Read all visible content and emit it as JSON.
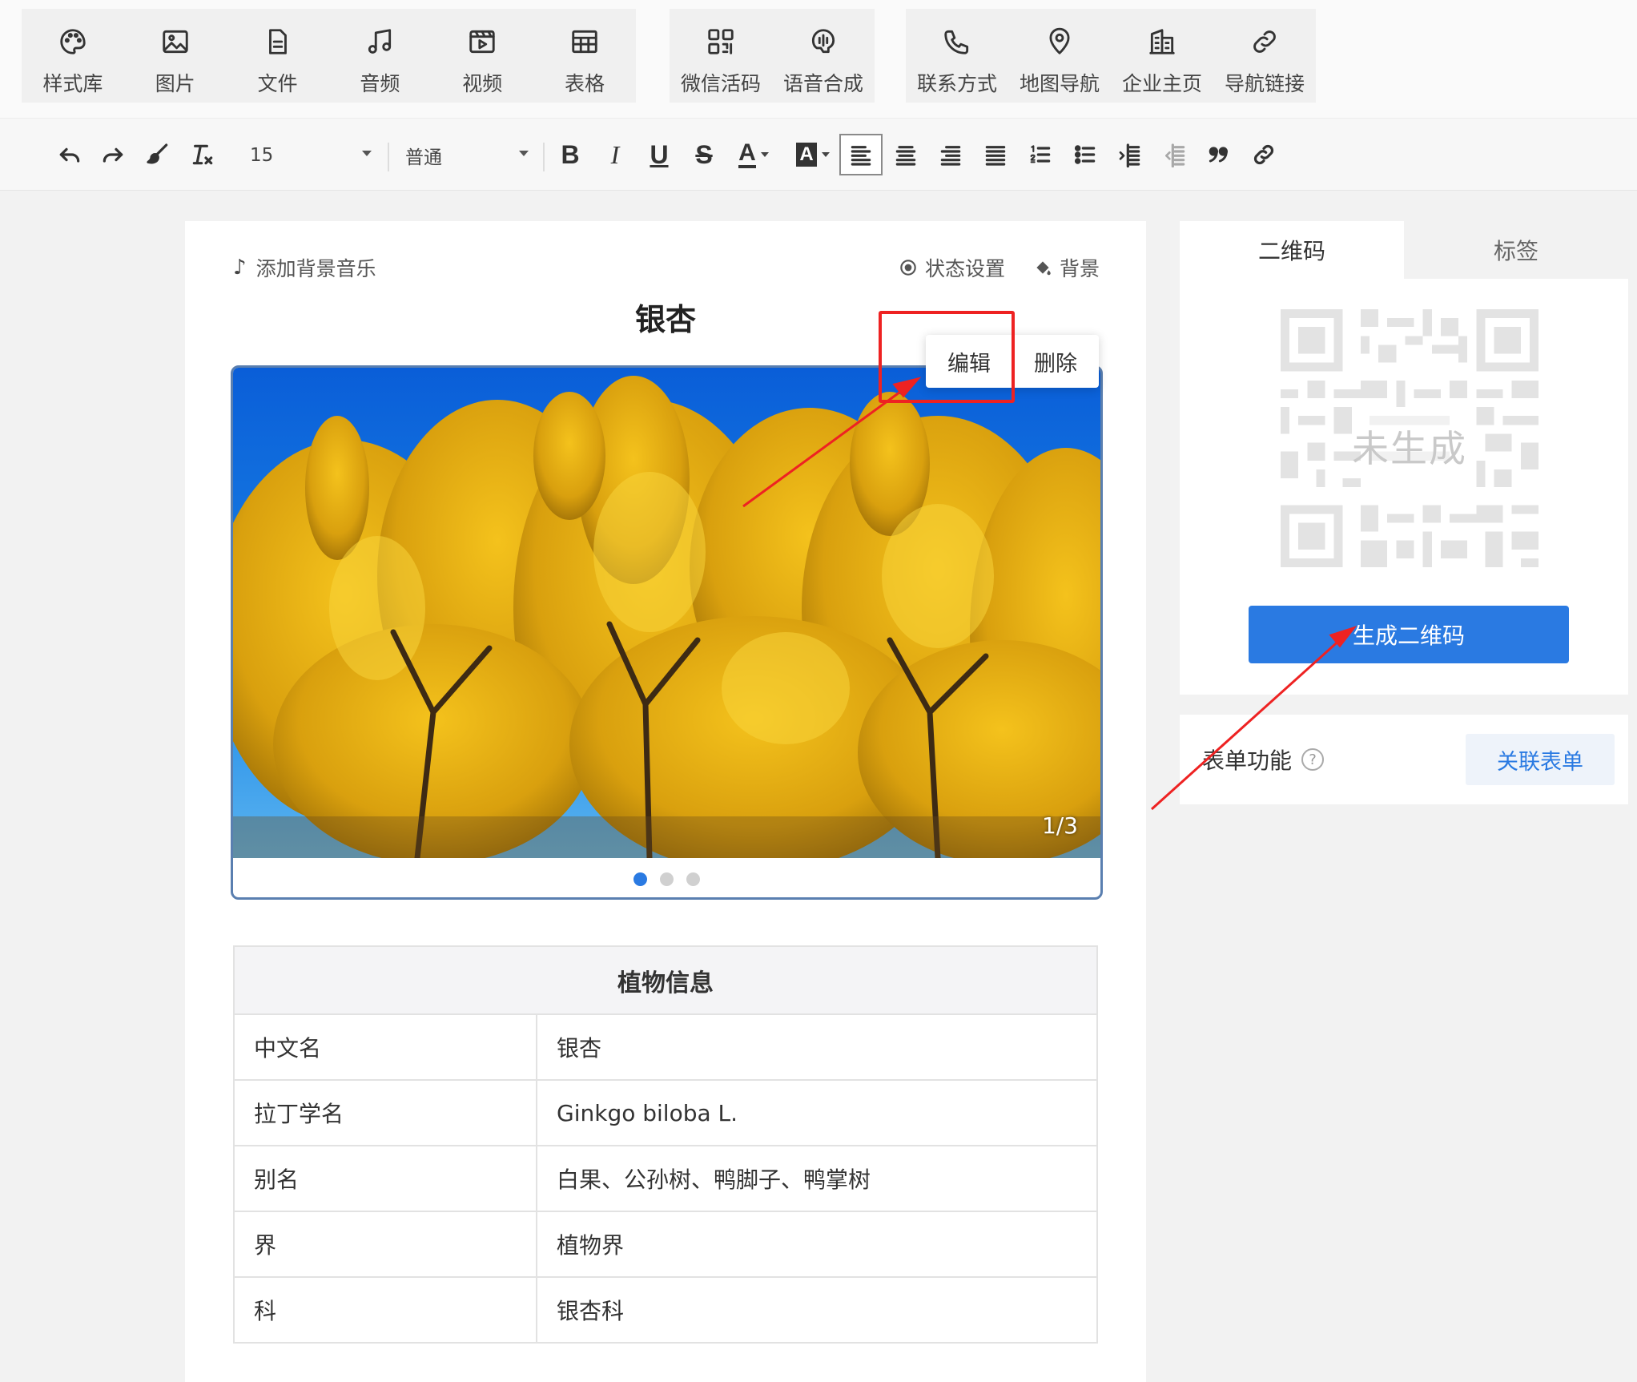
{
  "insert_toolbar": {
    "group1": [
      {
        "label": "样式库",
        "icon": "palette-icon"
      },
      {
        "label": "图片",
        "icon": "image-icon"
      },
      {
        "label": "文件",
        "icon": "file-icon"
      },
      {
        "label": "音频",
        "icon": "music-icon"
      },
      {
        "label": "视频",
        "icon": "video-icon"
      },
      {
        "label": "表格",
        "icon": "table-icon"
      }
    ],
    "group2": [
      {
        "label": "微信活码",
        "icon": "qrcode-icon"
      },
      {
        "label": "语音合成",
        "icon": "voice-icon"
      }
    ],
    "group3": [
      {
        "label": "联系方式",
        "icon": "phone-icon"
      },
      {
        "label": "地图导航",
        "icon": "map-pin-icon"
      },
      {
        "label": "企业主页",
        "icon": "building-icon"
      },
      {
        "label": "导航链接",
        "icon": "link-icon"
      }
    ]
  },
  "format_toolbar": {
    "font_size": "15",
    "paragraph_style": "普通",
    "bold_glyph": "B",
    "italic_glyph": "I",
    "underline_glyph": "U",
    "strike_glyph": "S",
    "font_color_glyph": "A",
    "bg_color_glyph": "A"
  },
  "editor": {
    "add_music": "添加背景音乐",
    "status_settings": "状态设置",
    "background": "背景",
    "title": "银杏",
    "carousel": {
      "counter": "1/3",
      "total_slides": 3,
      "active_slide": 1
    },
    "popover": {
      "edit": "编辑",
      "delete": "删除"
    },
    "table": {
      "header": "植物信息",
      "rows": [
        {
          "key": "中文名",
          "value": "银杏"
        },
        {
          "key": "拉丁学名",
          "value": "Ginkgo biloba L."
        },
        {
          "key": "别名",
          "value": "白果、公孙树、鸭脚子、鸭掌树"
        },
        {
          "key": "界",
          "value": "植物界"
        },
        {
          "key": "科",
          "value": "银杏科"
        }
      ]
    }
  },
  "qr_panel": {
    "tabs": [
      "二维码",
      "标签"
    ],
    "active_tab": "二维码",
    "placeholder": "未生成",
    "generate_button": "生成二维码"
  },
  "form_panel": {
    "label": "表单功能",
    "help_glyph": "?",
    "link_button": "关联表单"
  },
  "colors": {
    "accent": "#2a7ae2",
    "annotation_red": "#ee2222"
  }
}
